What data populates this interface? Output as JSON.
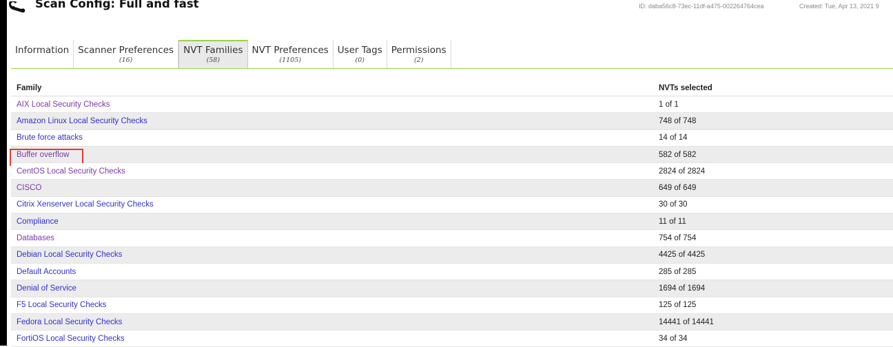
{
  "header": {
    "title": "Scan Config: Full and fast",
    "id_text": "ID: daba56c8-73ec-11df-a475-002264764cea",
    "created_text": "Created: Tue, Apr 13, 2021 9"
  },
  "tabs": [
    {
      "label": "Information",
      "count": ""
    },
    {
      "label": "Scanner Preferences",
      "count": "(16)"
    },
    {
      "label": "NVT Families",
      "count": "(58)"
    },
    {
      "label": "NVT Preferences",
      "count": "(1105)"
    },
    {
      "label": "User Tags",
      "count": "(0)"
    },
    {
      "label": "Permissions",
      "count": "(2)"
    }
  ],
  "active_tab": "NVT Families",
  "table": {
    "headers": {
      "family": "Family",
      "nvts": "NVTs selected"
    },
    "rows": [
      {
        "family": "AIX Local Security Checks",
        "nvts": "1 of 1"
      },
      {
        "family": "Amazon Linux Local Security Checks",
        "nvts": "748 of 748"
      },
      {
        "family": "Brute force attacks",
        "nvts": "14 of 14"
      },
      {
        "family": "Buffer overflow",
        "nvts": "582 of 582"
      },
      {
        "family": "CentOS Local Security Checks",
        "nvts": "2824 of 2824"
      },
      {
        "family": "CISCO",
        "nvts": "649 of 649"
      },
      {
        "family": "Citrix Xenserver Local Security Checks",
        "nvts": "30 of 30"
      },
      {
        "family": "Compliance",
        "nvts": "11 of 11"
      },
      {
        "family": "Databases",
        "nvts": "754 of 754"
      },
      {
        "family": "Debian Local Security Checks",
        "nvts": "4425 of 4425"
      },
      {
        "family": "Default Accounts",
        "nvts": "285 of 285"
      },
      {
        "family": "Denial of Service",
        "nvts": "1694 of 1694"
      },
      {
        "family": "F5 Local Security Checks",
        "nvts": "125 of 125"
      },
      {
        "family": "Fedora Local Security Checks",
        "nvts": "14441 of 14441"
      },
      {
        "family": "FortiOS Local Security Checks",
        "nvts": "34 of 34"
      }
    ]
  },
  "colors": {
    "link": "#3030cc",
    "visited_link": "#7a3aa8",
    "tab_accent": "#9ad24a",
    "highlight": "#e53935"
  },
  "icons": {
    "title_icon": "wrench-icon"
  }
}
